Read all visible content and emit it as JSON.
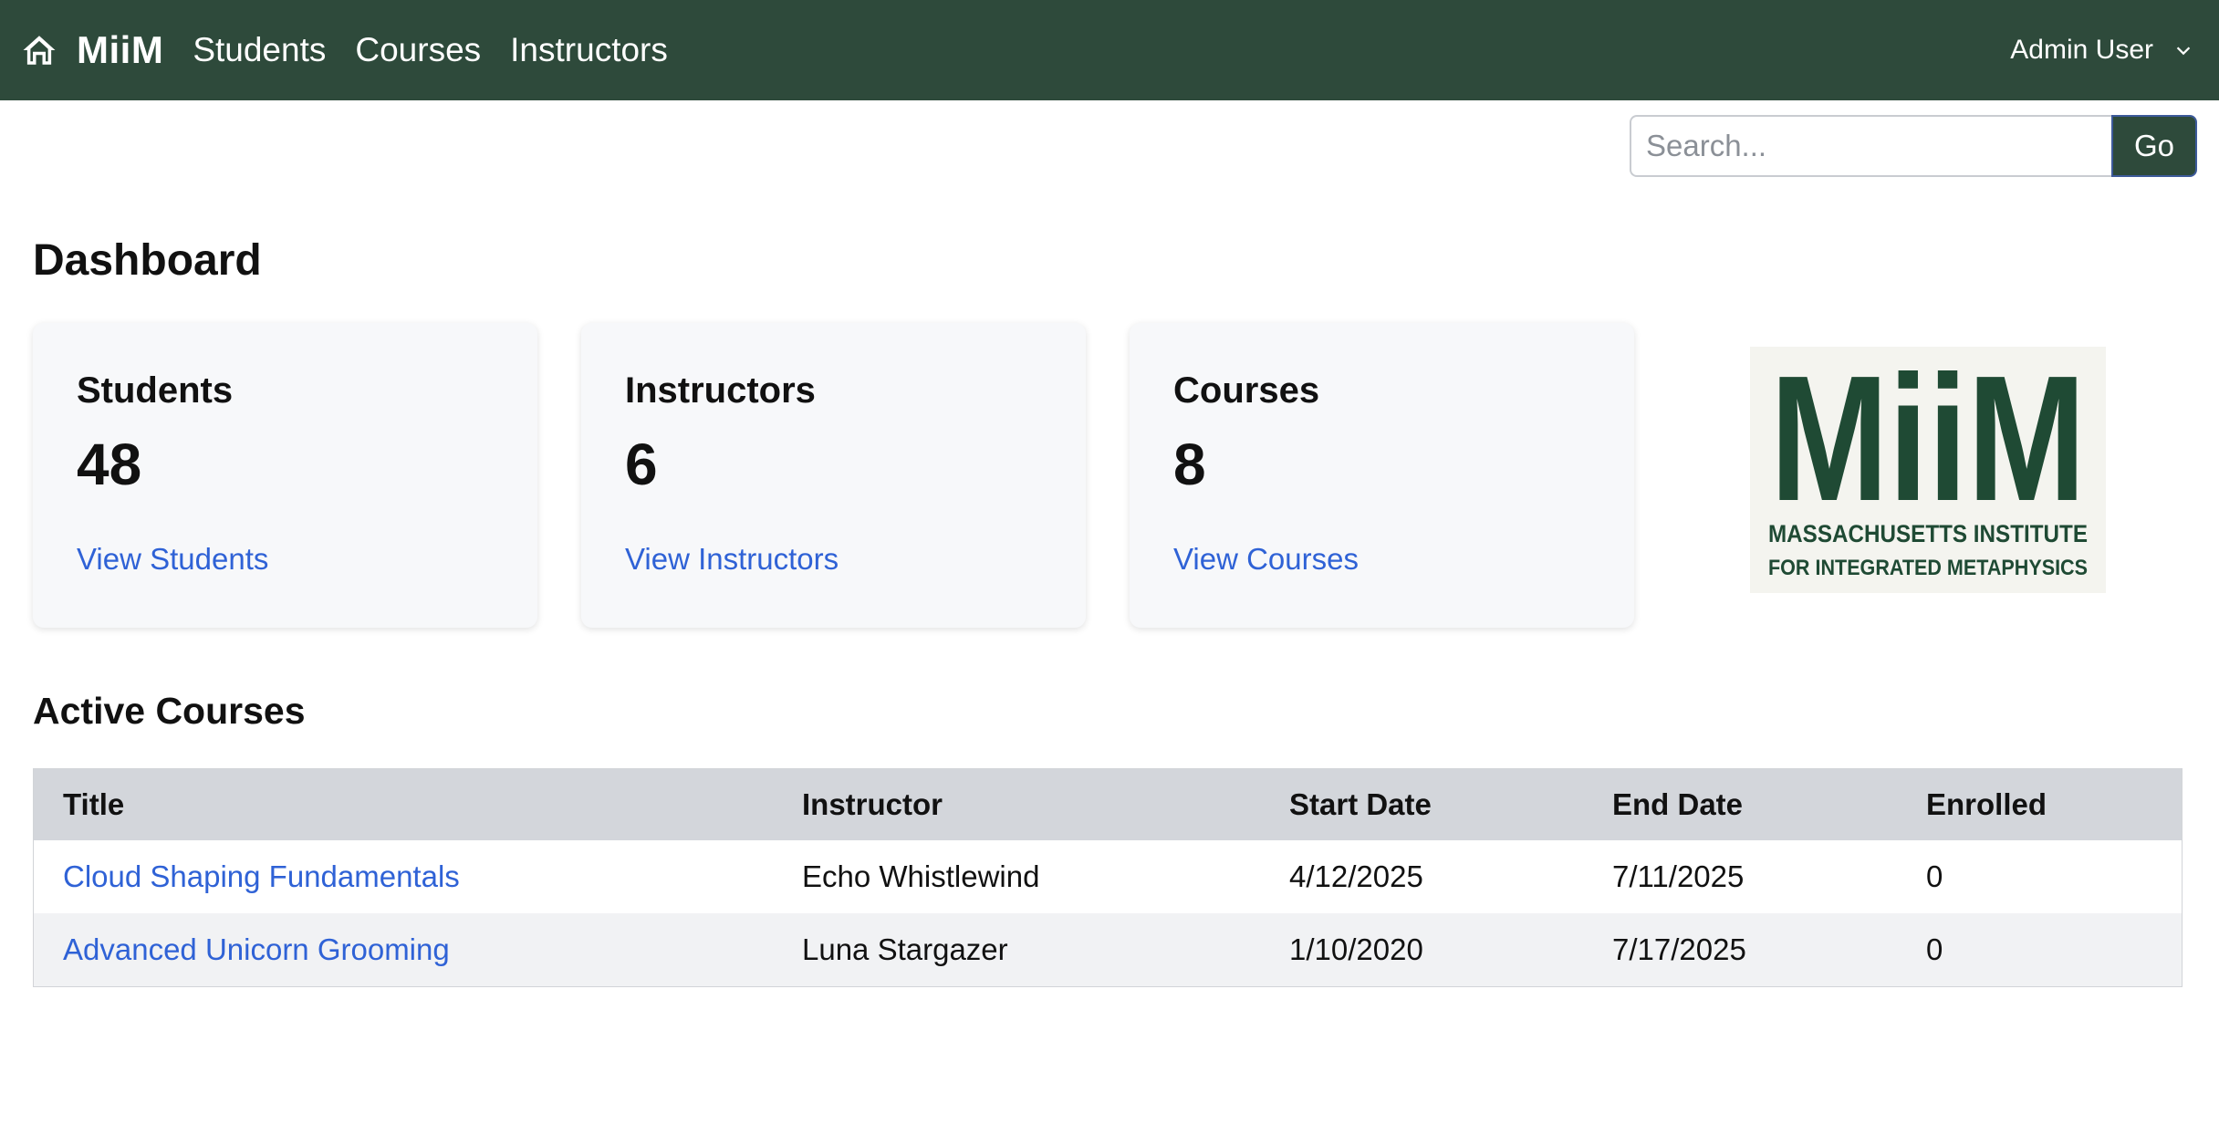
{
  "navbar": {
    "brand": "MiiM",
    "links": [
      "Students",
      "Courses",
      "Instructors"
    ],
    "user": "Admin User",
    "bg_color": "#2e4a3b"
  },
  "search": {
    "placeholder": "Search...",
    "button_label": "Go"
  },
  "page_title": "Dashboard",
  "cards": [
    {
      "title": "Students",
      "count": "48",
      "link": "View Students"
    },
    {
      "title": "Instructors",
      "count": "6",
      "link": "View Instructors"
    },
    {
      "title": "Courses",
      "count": "8",
      "link": "View Courses"
    }
  ],
  "logo": {
    "mark": "MiiM",
    "line1": "MASSACHUSETTS INSTITUTE",
    "line2": "FOR INTEGRATED METAPHYSICS",
    "color": "#1f4a34"
  },
  "active_courses": {
    "title": "Active Courses",
    "columns": [
      "Title",
      "Instructor",
      "Start Date",
      "End Date",
      "Enrolled"
    ],
    "rows": [
      [
        "Cloud Shaping Fundamentals",
        "Echo Whistlewind",
        "4/12/2025",
        "7/11/2025",
        "0"
      ],
      [
        "Advanced Unicorn Grooming",
        "Luna Stargazer",
        "1/10/2020",
        "7/17/2025",
        "0"
      ]
    ]
  },
  "colors": {
    "link": "#2f62d6",
    "header_row": "#d3d6db"
  }
}
